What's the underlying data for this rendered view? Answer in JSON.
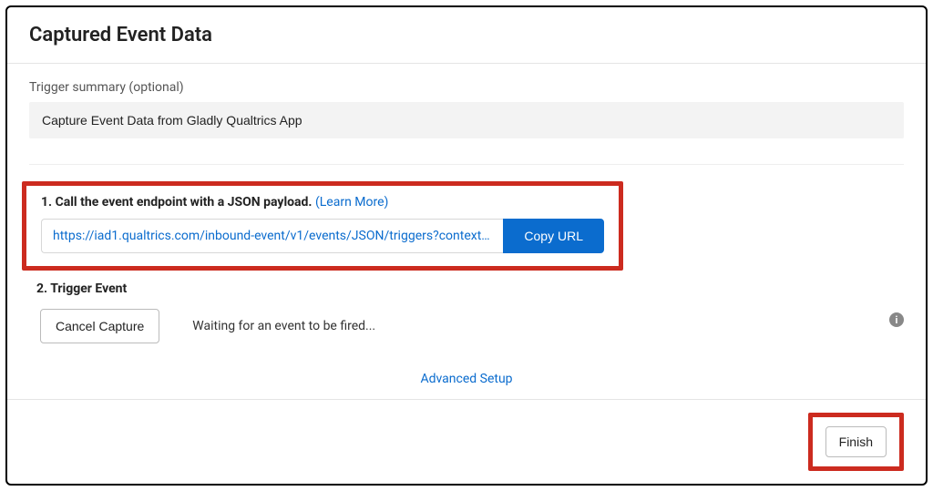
{
  "header": {
    "title": "Captured Event Data"
  },
  "summary": {
    "label": "Trigger summary (optional)",
    "value": "Capture Event Data from Gladly Qualtrics App"
  },
  "step1": {
    "title_prefix": "1. Call the event endpoint with a JSON payload. ",
    "learn_more": "(Learn More)",
    "url": "https://iad1.qualtrics.com/inbound-event/v1/events/JSON/triggers?contextI...",
    "copy_label": "Copy URL"
  },
  "step2": {
    "title": "2. Trigger Event",
    "cancel_label": "Cancel Capture",
    "waiting_text": "Waiting for an event to be fired...",
    "info_glyph": "i"
  },
  "advanced": {
    "label": "Advanced Setup"
  },
  "footer": {
    "finish_label": "Finish"
  }
}
